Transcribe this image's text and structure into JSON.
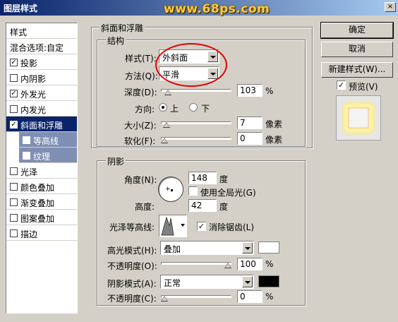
{
  "window": {
    "title": "图层样式",
    "watermark": "www.68ps.com",
    "close_glyph": "×"
  },
  "left_list": {
    "header": "样式",
    "blend": "混合选项:自定",
    "items": [
      {
        "label": "投影",
        "checked": true
      },
      {
        "label": "内阴影",
        "checked": false
      },
      {
        "label": "外发光",
        "checked": true
      },
      {
        "label": "内发光",
        "checked": false
      },
      {
        "label": "斜面和浮雕",
        "checked": true,
        "selected": true
      },
      {
        "label": "等高线",
        "checked": false,
        "sub": true
      },
      {
        "label": "纹理",
        "checked": false,
        "sub": true
      },
      {
        "label": "光泽",
        "checked": false
      },
      {
        "label": "颜色叠加",
        "checked": false
      },
      {
        "label": "渐变叠加",
        "checked": false
      },
      {
        "label": "图案叠加",
        "checked": false
      },
      {
        "label": "描边",
        "checked": false
      }
    ],
    "check_glyph": "✓"
  },
  "bevel": {
    "section_title": "斜面和浮雕",
    "structure_title": "结构",
    "style_label": "样式(T):",
    "style_value": "外斜面",
    "technique_label": "方法(Q):",
    "technique_value": "平滑",
    "depth_label": "深度(D):",
    "depth_value": "103",
    "depth_unit": "%",
    "depth_level": 0.06,
    "direction_label": "方向:",
    "direction_up": "上",
    "direction_down": "下",
    "size_label": "大小(Z):",
    "size_value": "7",
    "size_unit": "像素",
    "size_level": 0.03,
    "soften_label": "软化(F):",
    "soften_value": "0",
    "soften_unit": "像素",
    "soften_level": 0.0
  },
  "shading": {
    "title": "阴影",
    "angle_label": "角度(N):",
    "angle_value": "148",
    "angle_unit": "度",
    "global_light_label": "使用全局光(G)",
    "altitude_label": "高度:",
    "altitude_value": "42",
    "altitude_unit": "度",
    "gloss_label": "光泽等高线:",
    "antialias_label": "消除锯齿(L)",
    "highlight_mode_label": "高光模式(H):",
    "highlight_mode_value": "叠加",
    "highlight_color": "#ffffff",
    "highlight_opacity_label": "不透明度(O):",
    "highlight_opacity_value": "100",
    "highlight_opacity_level": 1.0,
    "shadow_mode_label": "阴影模式(A):",
    "shadow_mode_value": "正常",
    "shadow_color": "#000000",
    "shadow_opacity_label": "不透明度(C):",
    "shadow_opacity_value": "0",
    "shadow_opacity_level": 0.0,
    "pct": "%"
  },
  "buttons": {
    "ok": "确定",
    "cancel": "取消",
    "new_style": "新建样式(W)...",
    "preview": "预览(V)"
  },
  "colors": {
    "accent": "#0a246a",
    "highlight_ring": "#e00000",
    "preview_glow": "#ffee88"
  }
}
